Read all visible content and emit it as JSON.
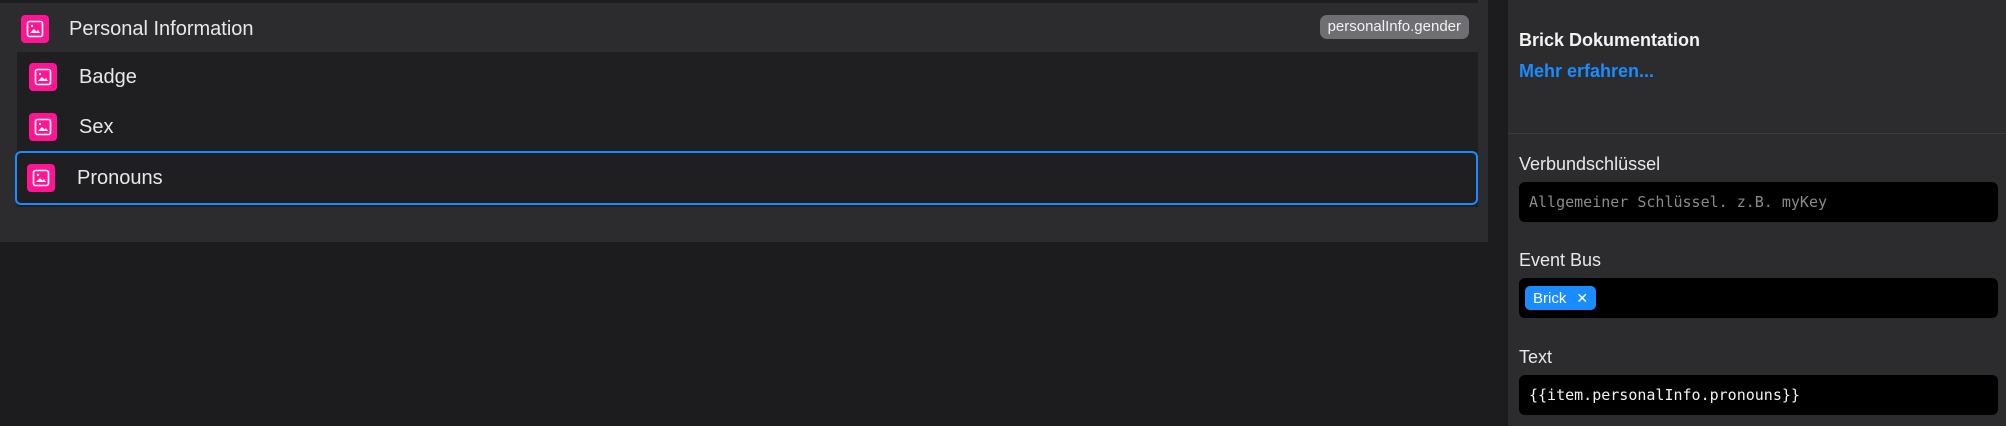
{
  "tree": {
    "group": {
      "label": "Personal Information",
      "icon": "image-icon",
      "tag": "personalInfo.gender"
    },
    "children": [
      {
        "label": "Badge",
        "icon": "image-icon",
        "selected": false
      },
      {
        "label": "Sex",
        "icon": "image-icon",
        "selected": false
      },
      {
        "label": "Pronouns",
        "icon": "image-icon",
        "selected": true
      }
    ]
  },
  "properties": {
    "doc_title": "Brick Dokumentation",
    "doc_link": "Mehr erfahren...",
    "fields": {
      "composite_key": {
        "label": "Verbundschlüssel",
        "placeholder": "Allgemeiner Schlüssel. z.B. myKey",
        "value": ""
      },
      "event_bus": {
        "label": "Event Bus",
        "chips": [
          "Brick"
        ]
      },
      "text": {
        "label": "Text",
        "value": "{{item.personalInfo.pronouns}}"
      }
    }
  },
  "colors": {
    "accent": "#1a8cff",
    "brick_icon": "#ff1493",
    "panel": "#2c2c2e",
    "background": "#1c1c1e"
  }
}
